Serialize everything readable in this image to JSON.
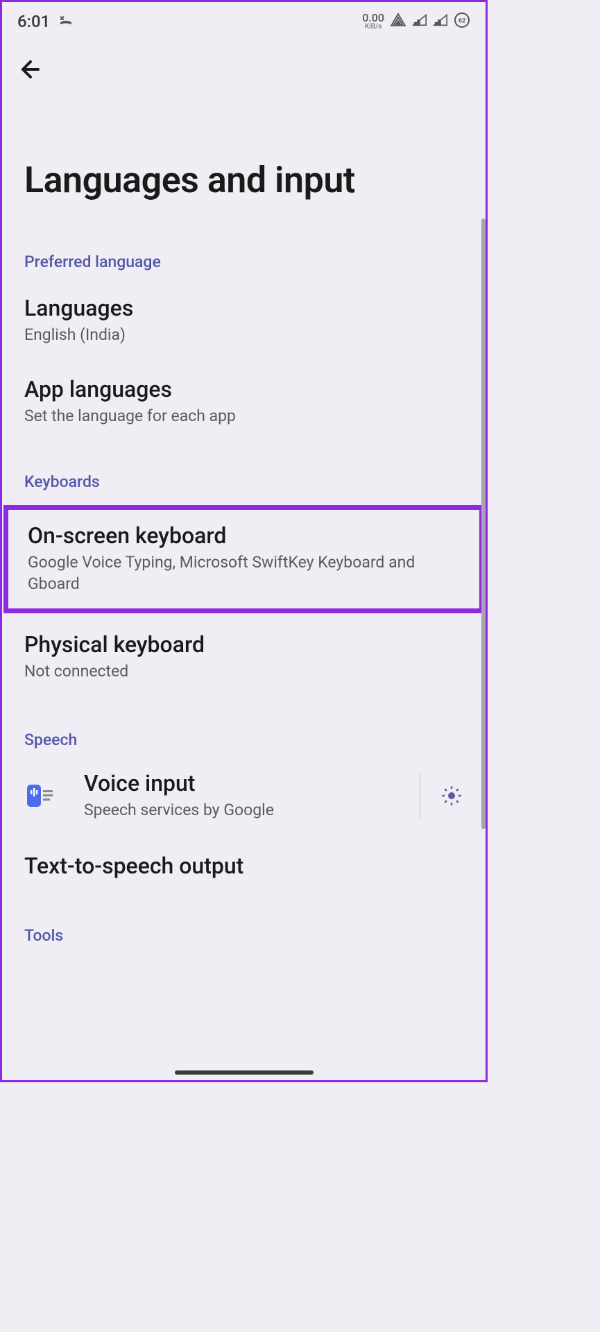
{
  "status": {
    "time": "6:01",
    "kib_value": "0.00",
    "kib_unit": "KiB/s",
    "battery": "62"
  },
  "page": {
    "title": "Languages and input"
  },
  "sections": [
    {
      "header": "Preferred language",
      "items": [
        {
          "title": "Languages",
          "subtitle": "English (India)"
        },
        {
          "title": "App languages",
          "subtitle": "Set the language for each app"
        }
      ]
    },
    {
      "header": "Keyboards",
      "items": [
        {
          "title": "On-screen keyboard",
          "subtitle": "Google Voice Typing, Microsoft SwiftKey Keyboard and Gboard",
          "highlighted": true
        },
        {
          "title": "Physical keyboard",
          "subtitle": "Not connected"
        }
      ]
    },
    {
      "header": "Speech",
      "items": [
        {
          "title": "Voice input",
          "subtitle": "Speech services by Google",
          "icon": true,
          "gear": true
        },
        {
          "title": "Text-to-speech output",
          "subtitle": ""
        }
      ]
    },
    {
      "header": "Tools",
      "items": []
    }
  ]
}
